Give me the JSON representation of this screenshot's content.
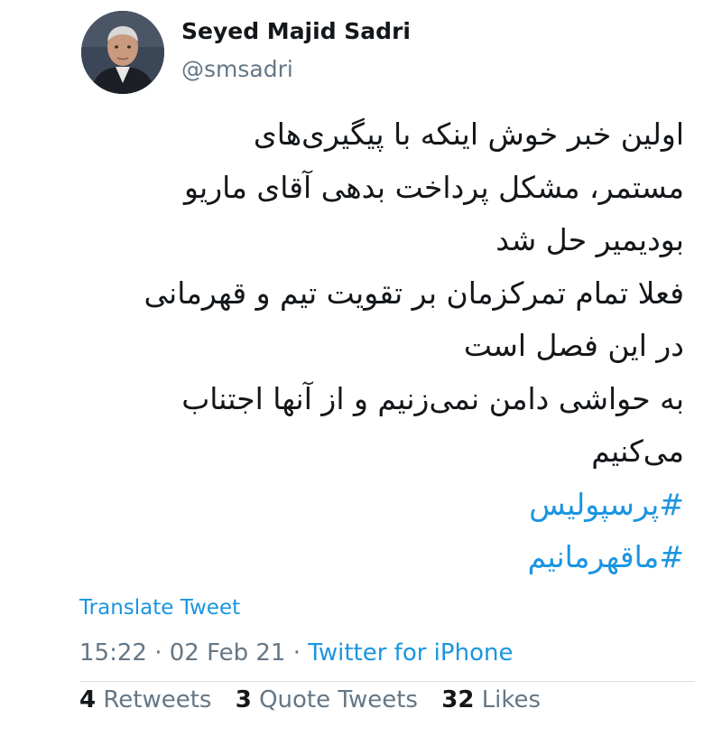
{
  "author": {
    "display_name": "Seyed Majid Sadri",
    "handle": "@smsadri",
    "avatar_icon": "profile-photo"
  },
  "tweet": {
    "lines": [
      "اولین خبر خوش اینکه با پیگیری‌های",
      "مستمر، مشکل پرداخت بدهی آقای ماریو",
      "بودیمیر حل شد",
      "فعلا تمام تمرکزمان بر تقویت تیم و قهرمانی",
      "در این فصل است",
      "به حواشی دامن نمی‌زنیم و از آنها اجتناب",
      "می‌کنیم"
    ],
    "hashtags": [
      "#پرسپولیس",
      "#ماقهرمانیم"
    ]
  },
  "translate_label": "Translate Tweet",
  "meta": {
    "time": "15:22",
    "separator": "·",
    "date": "02 Feb 21",
    "source": "Twitter for iPhone"
  },
  "stats": {
    "retweets_count": "4",
    "retweets_label": "Retweets",
    "quotes_count": "3",
    "quotes_label": "Quote Tweets",
    "likes_count": "32",
    "likes_label": "Likes"
  },
  "colors": {
    "link": "#1b95e0",
    "text": "#14171a",
    "secondary": "#657786"
  }
}
